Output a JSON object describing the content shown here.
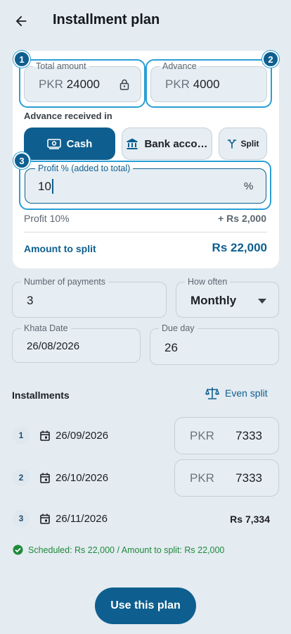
{
  "header": {
    "title": "Installment plan"
  },
  "amounts": {
    "total_label": "Total amount",
    "total_prefix": "PKR",
    "total_value": "24000",
    "advance_label": "Advance",
    "advance_prefix": "PKR",
    "advance_value": "4000"
  },
  "badges": {
    "one": "1",
    "two": "2",
    "three": "3"
  },
  "advance_received": {
    "label": "Advance received in",
    "options": [
      {
        "label": "Cash"
      },
      {
        "label": "Bank acco…"
      },
      {
        "label": "Split"
      }
    ],
    "selected": "Cash"
  },
  "profit": {
    "label": "Profit % (added to total)",
    "value": "10",
    "suffix": "%",
    "summary_label": "Profit 10%",
    "summary_value": "+ Rs 2,000"
  },
  "split": {
    "label": "Amount to split",
    "value": "Rs 22,000"
  },
  "schedule": {
    "payments_label": "Number of payments",
    "payments_value": "3",
    "frequency_label": "How often",
    "frequency_value": "Monthly",
    "khata_label": "Khata Date",
    "khata_value": "26/08/2026",
    "dueday_label": "Due day",
    "dueday_value": "26"
  },
  "installments": {
    "title": "Installments",
    "even_split_label": "Even split",
    "items": [
      {
        "num": "1",
        "date": "26/09/2026",
        "prefix": "PKR",
        "amount": "7333"
      },
      {
        "num": "2",
        "date": "26/10/2026",
        "prefix": "PKR",
        "amount": "7333"
      },
      {
        "num": "3",
        "date": "26/11/2026",
        "amount": "Rs 7,334"
      }
    ]
  },
  "status": {
    "scheduled": "Scheduled: Rs 22,000",
    "separator": " / ",
    "to_split": "Amount to split: Rs 22,000"
  },
  "actions": {
    "use_plan": "Use this plan"
  },
  "colors": {
    "primary": "#0e5f8f",
    "highlight": "#2a9fd6",
    "success": "#1f8a3a"
  }
}
